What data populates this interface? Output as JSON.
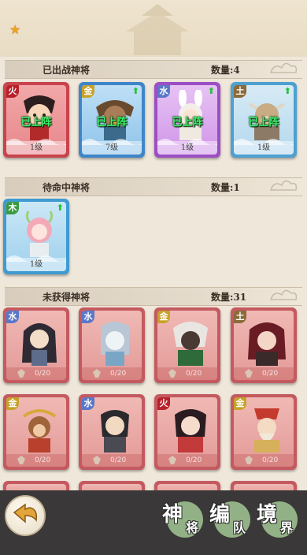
{
  "header": {
    "star_icon": "star-icon"
  },
  "sections": {
    "deployed": {
      "title": "已出战神将",
      "count": "数量:4"
    },
    "standby": {
      "title": "待命中神将",
      "count": "数量:1"
    },
    "unowned": {
      "title": "未获得神将",
      "count": "数量:31"
    }
  },
  "deployed_cards": [
    {
      "element": "火",
      "status": "已上阵",
      "level": "1级",
      "upgradable": false
    },
    {
      "element": "金",
      "status": "已上阵",
      "level": "7级",
      "upgradable": true
    },
    {
      "element": "水",
      "status": "已上阵",
      "level": "1级",
      "upgradable": true
    },
    {
      "element": "土",
      "status": "已上阵",
      "level": "1级",
      "upgradable": true
    }
  ],
  "standby_cards": [
    {
      "element": "木",
      "level": "1级",
      "upgradable": true
    }
  ],
  "unowned_cards": [
    {
      "element": "水",
      "fragments": "0/20"
    },
    {
      "element": "水",
      "fragments": "0/20"
    },
    {
      "element": "金",
      "fragments": "0/20"
    },
    {
      "element": "土",
      "fragments": "0/20"
    },
    {
      "element": "金",
      "fragments": "0/20"
    },
    {
      "element": "水",
      "fragments": "0/20"
    },
    {
      "element": "火",
      "fragments": "0/20"
    },
    {
      "element": "金",
      "fragments": "0/20"
    }
  ],
  "bottom_nav": {
    "gods": {
      "c1": "神",
      "c2": "将"
    },
    "team": {
      "c1": "编",
      "c2": "队"
    },
    "realm": {
      "c1": "境",
      "c2": "界"
    }
  }
}
